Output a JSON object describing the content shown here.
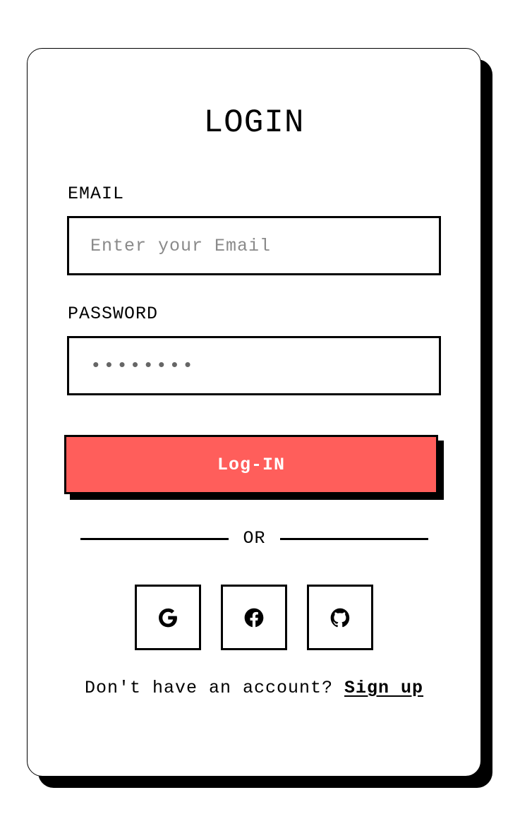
{
  "login": {
    "title": "LOGIN",
    "email_label": "EMAIL",
    "email_placeholder": "Enter your Email",
    "email_value": "",
    "password_label": "PASSWORD",
    "password_value": "••••••••",
    "submit_label": "Log-IN",
    "divider_text": "OR",
    "social_buttons": [
      {
        "provider": "google",
        "icon": "google-icon"
      },
      {
        "provider": "facebook",
        "icon": "facebook-icon"
      },
      {
        "provider": "github",
        "icon": "github-icon"
      }
    ],
    "signup_prompt": "Don't have an account?",
    "signup_link": "Sign up"
  },
  "colors": {
    "accent": "#ff5e5b",
    "border": "#000000",
    "background": "#ffffff",
    "placeholder": "#8a8a8a"
  }
}
